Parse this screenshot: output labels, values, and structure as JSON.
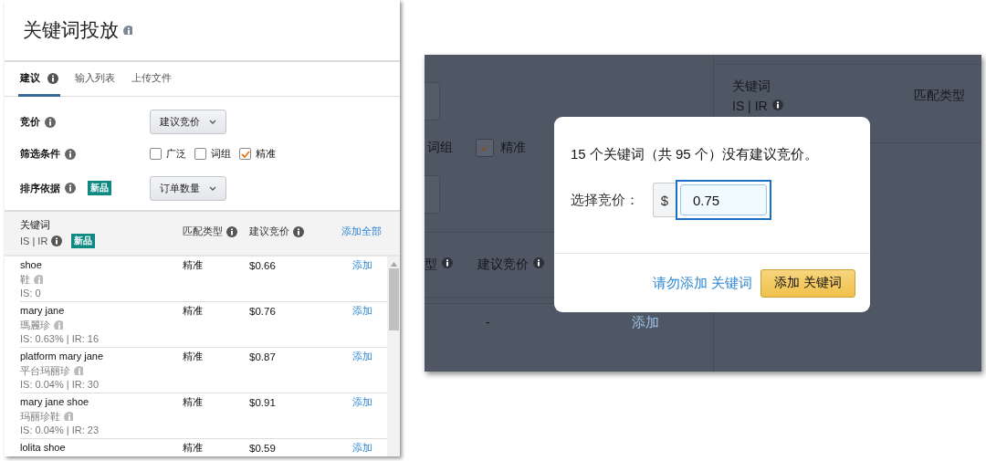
{
  "keyword_panel": {
    "title": "关键词投放",
    "tabs": [
      {
        "label": "建议",
        "selected": true,
        "info": true
      },
      {
        "label": "输入列表",
        "selected": false,
        "info": false
      },
      {
        "label": "上传文件",
        "selected": false,
        "info": false
      }
    ],
    "bid": {
      "label": "竞价",
      "dropdown": "建议竞价"
    },
    "filter": {
      "label": "筛选条件",
      "options": [
        {
          "label": "广泛",
          "checked": false
        },
        {
          "label": "词组",
          "checked": false
        },
        {
          "label": "精准",
          "checked": true
        }
      ]
    },
    "sort": {
      "label": "排序依据",
      "badge": "新品",
      "dropdown": "订单数量"
    },
    "table": {
      "columns": [
        {
          "label": "关键词",
          "sub": "IS | IR",
          "badge": "新品"
        },
        {
          "label": "匹配类型"
        },
        {
          "label": "建议竞价"
        }
      ],
      "add_all": "添加全部",
      "rows": [
        {
          "keyword": "shoe",
          "translation": "鞋",
          "stats": "IS: 0",
          "match": "精准",
          "bid": "$0.66",
          "action": "添加"
        },
        {
          "keyword": "mary jane",
          "translation": "瑪麗珍",
          "stats": "IS: 0.63% | IR: 16",
          "match": "精准",
          "bid": "$0.76",
          "action": "添加"
        },
        {
          "keyword": "platform mary jane",
          "translation": "平台玛丽珍",
          "stats": "IS: 0.04% | IR: 30",
          "match": "精准",
          "bid": "$0.87",
          "action": "添加"
        },
        {
          "keyword": "mary jane shoe",
          "translation": "玛丽珍鞋",
          "stats": "IS: 0.04% | IR: 23",
          "match": "精准",
          "bid": "$0.91",
          "action": "添加"
        },
        {
          "keyword": "lolita shoe",
          "match": "精准",
          "bid": "$0.59",
          "action": "添加"
        }
      ]
    }
  },
  "dialog_screen": {
    "background": {
      "filter_option_partial": "词组",
      "filter_option": {
        "label": "精准",
        "checked": true
      },
      "columns": [
        "型",
        "建议竞价"
      ],
      "row": {
        "bid": "-",
        "action": "添加"
      },
      "side_columns": {
        "keyword": "关键词",
        "sub": "IS | IR",
        "match": "匹配类型"
      }
    },
    "dialog": {
      "message": "15 个关键词（共 95 个）没有建议竞价。",
      "bid_label": "选择竞价：",
      "currency": "$",
      "bid_value": "0.75",
      "cancel": "请勿添加 关键词",
      "confirm": "添加 关键词"
    }
  }
}
